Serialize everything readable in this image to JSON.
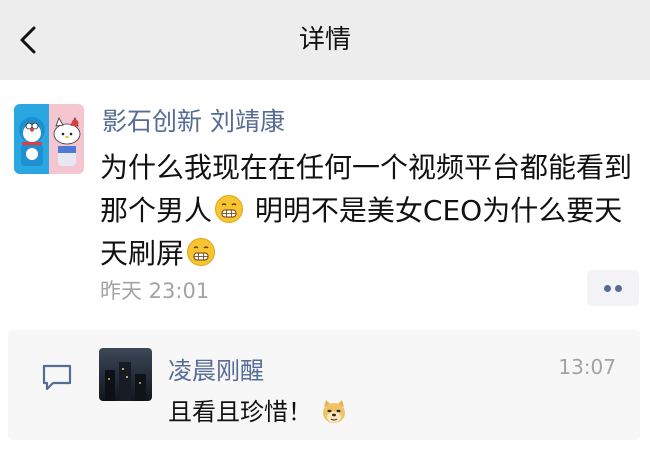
{
  "nav": {
    "title": "详情"
  },
  "post": {
    "author": "影石创新 刘靖康",
    "text_part1": "为什么我现在在任何一个视频平台都能看到那个男人",
    "text_part2": "明明不是美女CEO为什么要天天刷屏",
    "emoji": "grimace-emoji",
    "time": "昨天 23:01"
  },
  "comment": {
    "author": "凌晨刚醒",
    "time": "13:07",
    "text": "且看且珍惜！",
    "emoji": "doge-emoji"
  },
  "colors": {
    "link": "#566b95",
    "nav_bg": "#ededed",
    "comment_bg": "#f7f7f7",
    "meta": "#a3a3a3"
  }
}
